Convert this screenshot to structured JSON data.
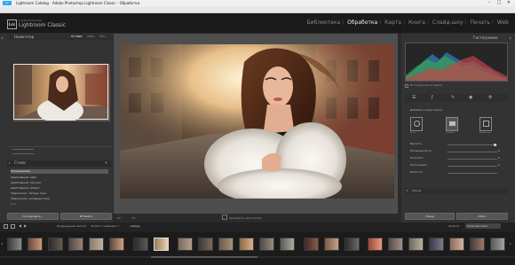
{
  "window": {
    "title": "Lightroom Catalog - Adobe Photoshop Lightroom Classic - Обработка",
    "controls": [
      "–",
      "□",
      "✕"
    ]
  },
  "menu": [
    "Файл",
    "Редактирование",
    "Обработка",
    "Фото",
    "Настройки",
    "Инструменты",
    "Просмотр",
    "Окно",
    "Справка"
  ],
  "identity": {
    "logo": "Lrc",
    "sub": "Adobe Photoshop",
    "main": "Lightroom Classic"
  },
  "modules": {
    "items": [
      "Библиотека",
      "Обработка",
      "Карта",
      "Книга",
      "Слайд-шоу",
      "Печать",
      "Web"
    ],
    "active_index": 1
  },
  "navigator": {
    "title": "Навигатор",
    "zoom_options": [
      "ПО ВЫБ.",
      "100%",
      "50%"
    ]
  },
  "presets": {
    "title": "Стили",
    "items": [
      "Пользователь",
      "Адаптивный: небо",
      "Адаптивный: портрет",
      "Адаптивный: объект",
      "Творческое: тёплые тона",
      "Творческое: холодные тона"
    ],
    "selected_index": 0,
    "copy_button": "Скопировать...",
    "paste_button": "Вставить"
  },
  "toolbar": {
    "softproof_label": "Проверить цветопробу",
    "before_after": "Y|Y"
  },
  "histogram": {
    "title": "Гистограмма",
    "original_label": "Исходная фотография"
  },
  "tools": [
    "crop-icon",
    "heal-icon",
    "brush-icon",
    "redeye-icon",
    "mask-icon"
  ],
  "basic": {
    "profile_label": "Добавить новую маску",
    "mask_buttons": [
      "Кисть",
      "Градиент",
      "Радиальный"
    ],
    "sliders": [
      {
        "label": "Яркость",
        "value": "0"
      },
      {
        "label": "Насыщенность",
        "value": "0"
      },
      {
        "label": "Контраст",
        "value": "0"
      },
      {
        "label": "Экспозиция",
        "value": "0"
      },
      {
        "label": "Резкость",
        "value": "0"
      }
    ],
    "section_title": "Линзы",
    "prev_button": "Назад",
    "reset_button": "Сброс"
  },
  "filmstrip": {
    "source": "Предыдущий импорт",
    "count_text": "16 фото / выбрано 1",
    "filename": "/ slkayg",
    "filter_label": "Фильтр:",
    "filter_value": "Фильтры выкл."
  },
  "colors": {
    "accent": "#f2f2f2",
    "panel": "#333333",
    "background": "#2b2b2b"
  }
}
